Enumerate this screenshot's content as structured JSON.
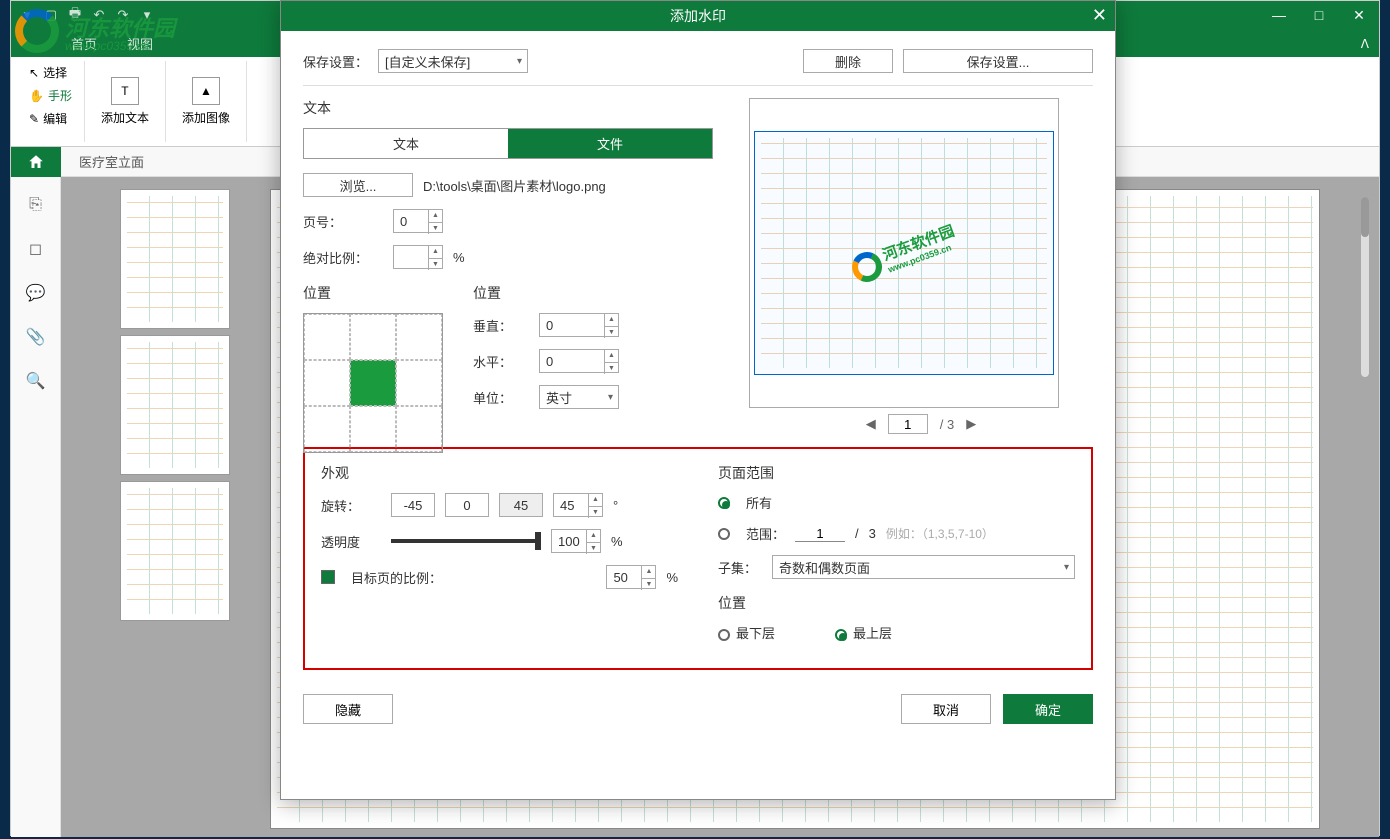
{
  "app": {
    "ribbon_tabs": [
      "首页",
      "视图"
    ],
    "win": {
      "min": "—",
      "max": "□",
      "close": "✕"
    }
  },
  "watermark_site": {
    "name": "河东软件园",
    "url": "www.pc0359.cn"
  },
  "ribbon": {
    "select": "选择",
    "hand": "手形",
    "edit": "编辑",
    "add_text": "添加文本",
    "add_image": "添加图像"
  },
  "doc_tab": "医疗室立面",
  "dialog": {
    "title": "添加水印",
    "close": "✕",
    "save_settings_label": "保存设置：",
    "save_settings_value": "[自定义未保存]",
    "delete": "删除",
    "save_settings_btn": "保存设置...",
    "text_section": "文本",
    "tab_text": "文本",
    "tab_file": "文件",
    "browse": "浏览...",
    "file_path": "D:\\tools\\桌面\\图片素材\\logo.png",
    "page_no_label": "页号：",
    "page_no_value": "0",
    "abs_ratio_label": "绝对比例：",
    "abs_ratio_unit": "%",
    "position_section_l": "位置",
    "position_section_r": "位置",
    "vertical_label": "垂直：",
    "vertical_value": "0",
    "horizontal_label": "水平：",
    "horizontal_value": "0",
    "unit_label": "单位：",
    "unit_value": "英寸",
    "preview_page": "1",
    "preview_total": "/ 3",
    "appearance_section": "外观",
    "rotate_label": "旋转：",
    "rotate_neg45": "-45",
    "rotate_0": "0",
    "rotate_45": "45",
    "rotate_value": "45",
    "rotate_unit": "°",
    "opacity_label": "透明度",
    "opacity_value": "100",
    "opacity_unit": "%",
    "target_ratio_label": "目标页的比例：",
    "target_ratio_value": "50",
    "target_ratio_unit": "%",
    "page_range_section": "页面范围",
    "all_label": "所有",
    "range_label": "范围：",
    "range_from": "1",
    "range_sep": "/",
    "range_to": "3",
    "range_example": "例如：（1,3,5,7-10）",
    "subset_label": "子集：",
    "subset_value": "奇数和偶数页面",
    "position_z_section": "位置",
    "bottom_label": "最下层",
    "top_label": "最上层",
    "hide": "隐藏",
    "cancel": "取消",
    "ok": "确定"
  }
}
